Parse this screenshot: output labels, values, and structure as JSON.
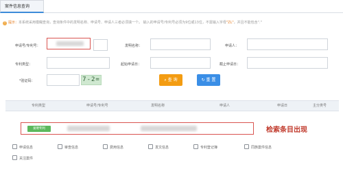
{
  "tab": {
    "label": "案件信息查询"
  },
  "notice": {
    "label": "提示：",
    "text_before": "本系统采用模糊查询，查询条件中的发明名称、申请号、申请人三者必须填一个。 输入的申请号/专利号必须为9位或13位，不需输入字母",
    "highlight": "\"ZL\"",
    "text_after": "，并且不能包含\".\""
  },
  "form": {
    "app_no_label": "申请号/专利号：",
    "invention_name_label": "发明名称：",
    "applicant_label": "申请人：",
    "agency_type_label": "专利类型：",
    "start_date_label": "起始申请日：",
    "end_date_label": "截止申请日：",
    "captcha_label": "*验证码：",
    "captcha_text": "7-2="
  },
  "buttons": {
    "search": "查 询",
    "reset": "重 置"
  },
  "table": {
    "headers": [
      "专利类型",
      "申请号/专利号",
      "发明名称",
      "申请人",
      "申请日",
      "主分类号"
    ]
  },
  "result": {
    "tag": "发明专利"
  },
  "annotation": "检索条目出现",
  "actions": [
    "申请信息",
    "审查信息",
    "费用信息",
    "发文信息",
    "专利登记簿",
    "同族案件信息",
    "关注案件"
  ],
  "colors": {
    "accent": "#3a8ee6",
    "search": "#f39c12",
    "highlight": "#d9534f",
    "tag": "#5cb85c"
  }
}
